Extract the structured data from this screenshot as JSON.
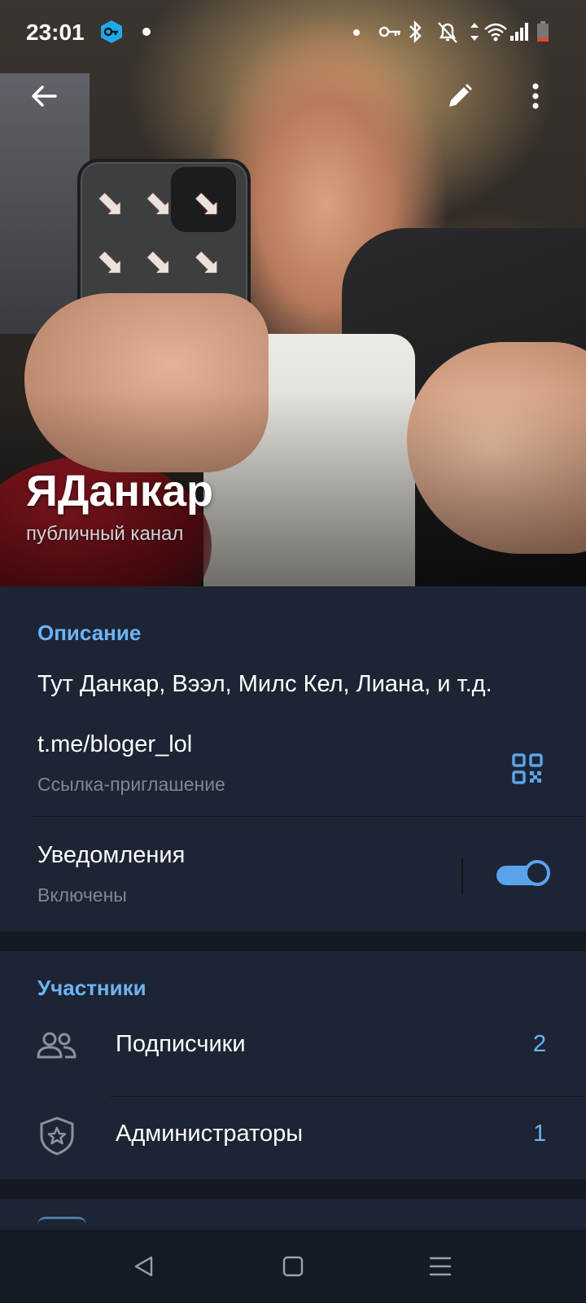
{
  "status_bar": {
    "time": "23:01",
    "icons": [
      "vpn-key-icon",
      "notification-dot-icon",
      "key-icon",
      "bluetooth-icon",
      "bell-muted-icon",
      "data-arrows-icon",
      "wifi-icon",
      "signal-icon",
      "battery-low-icon"
    ]
  },
  "toolbar": {
    "back_icon": "arrow-left-icon",
    "edit_icon": "pencil-icon",
    "menu_icon": "more-vertical-icon"
  },
  "header": {
    "channel_name": "ЯДанкар",
    "channel_type": "публичный канал"
  },
  "info": {
    "title": "Описание",
    "description": "Тут Данкар, Вээл, Милс Кел, Лиана, и т.д.",
    "link": "t.me/bloger_lol",
    "link_caption": "Ссылка-приглашение",
    "notifications_label": "Уведомления",
    "notifications_state": "Включены",
    "notifications_on": true
  },
  "members": {
    "title": "Участники",
    "items": [
      {
        "label": "Подписчики",
        "count": "2",
        "icon": "people-icon"
      },
      {
        "label": "Администраторы",
        "count": "1",
        "icon": "shield-star-icon"
      }
    ]
  },
  "colors": {
    "accent": "#6cb4f5",
    "background": "#1d2433",
    "section_gap": "#131821",
    "nav_bar": "#141a26"
  },
  "nav_bar": {
    "buttons": [
      "back-triangle-icon",
      "home-square-icon",
      "menu-lines-icon"
    ]
  }
}
